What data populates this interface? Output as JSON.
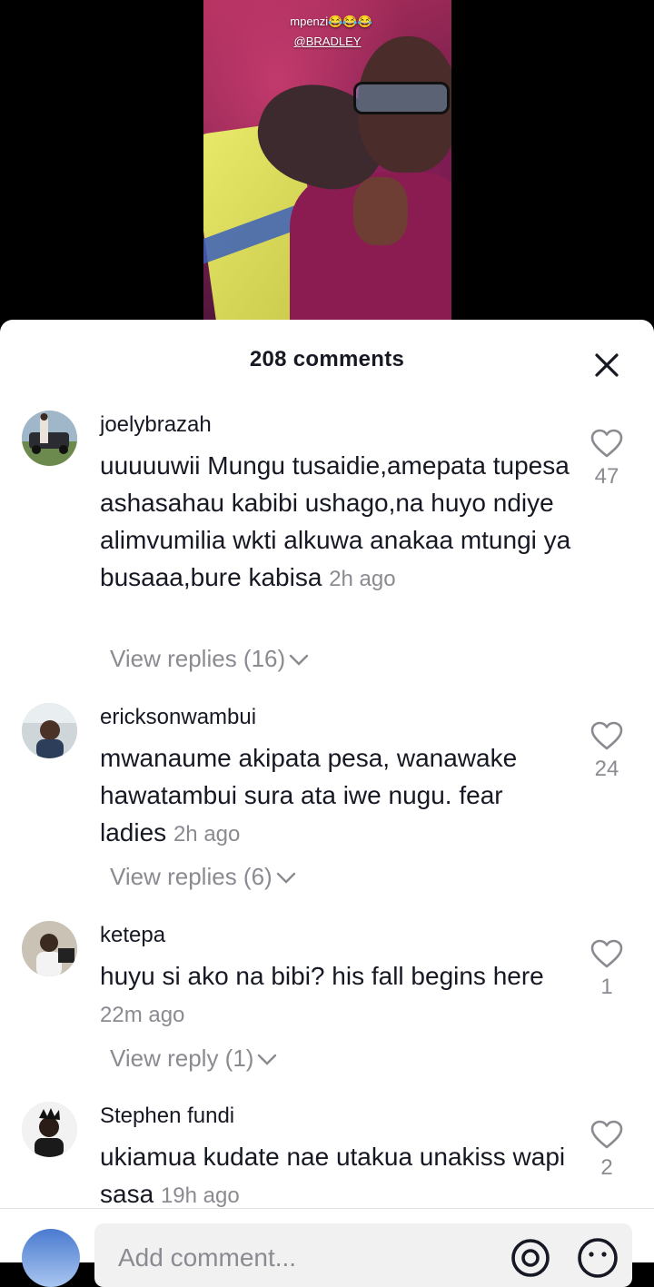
{
  "video": {
    "caption_line1": "mpenzi😂😂😂",
    "caption_line2": "@BRADLEY"
  },
  "sheet": {
    "title": "208 comments",
    "close_icon": "close-icon"
  },
  "comments": [
    {
      "username": "joelybrazah",
      "text": "uuuuuwii Mungu tusaidie,amepata tupesa ashasahau kabibi ushago,na huyo ndiye alimvumilia wkti alkuwa anakaa mtungi ya busaaa,bure kabisa",
      "time": "2h ago",
      "likes": "47",
      "replies": "View replies (16)"
    },
    {
      "username": "ericksonwambui",
      "text": "mwanaume akipata pesa, wanawake hawatambui sura ata iwe nugu. fear ladies",
      "time": "2h ago",
      "likes": "24",
      "replies": "View replies (6)"
    },
    {
      "username": "ketepa",
      "text": "huyu si ako na bibi? his fall begins here",
      "time": "22m ago",
      "likes": "1",
      "replies": "View reply (1)"
    },
    {
      "username": "Stephen fundi",
      "text": "ukiamua kudate nae utakua unakiss wapi sasa",
      "time": "19h ago",
      "likes": "2",
      "replies": ""
    }
  ],
  "input": {
    "placeholder": "Add comment..."
  },
  "colors": {
    "text": "#161823",
    "secondary": "#8a8b91",
    "input_bg": "#f1f1f2"
  }
}
